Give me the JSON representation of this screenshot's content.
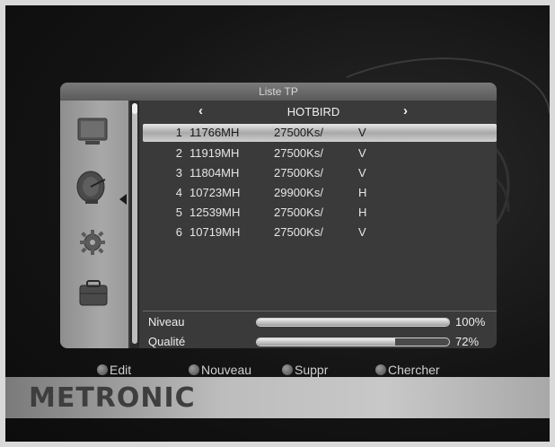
{
  "window": {
    "title": "Liste TP"
  },
  "satellite": {
    "left_arrow": "‹",
    "name": "HOTBIRD",
    "right_arrow": "›"
  },
  "transponders": [
    {
      "index": "1",
      "frequency": "11766MH",
      "symbol_rate": "27500Ks/",
      "polarization": "V",
      "selected": true
    },
    {
      "index": "2",
      "frequency": "11919MH",
      "symbol_rate": "27500Ks/",
      "polarization": "V"
    },
    {
      "index": "3",
      "frequency": "11804MH",
      "symbol_rate": "27500Ks/",
      "polarization": "V"
    },
    {
      "index": "4",
      "frequency": "10723MH",
      "symbol_rate": "29900Ks/",
      "polarization": "H"
    },
    {
      "index": "5",
      "frequency": "12539MH",
      "symbol_rate": "27500Ks/",
      "polarization": "H"
    },
    {
      "index": "6",
      "frequency": "10719MH",
      "symbol_rate": "27500Ks/",
      "polarization": "V"
    }
  ],
  "signal": {
    "level": {
      "label": "Niveau",
      "value": 100,
      "text": "100%"
    },
    "quality": {
      "label": "Qualité",
      "value": 72,
      "text": "72%"
    }
  },
  "sidebar": {
    "icons": [
      "tv-icon",
      "satellite-dish-icon",
      "gear-icon",
      "toolbox-icon"
    ],
    "selected_icon": "satellite-dish-icon"
  },
  "buttons": {
    "edit": "Edit",
    "new": "Nouveau",
    "delete": "Suppr",
    "search": "Chercher"
  },
  "brand": {
    "logo_text": "METRONIC"
  }
}
